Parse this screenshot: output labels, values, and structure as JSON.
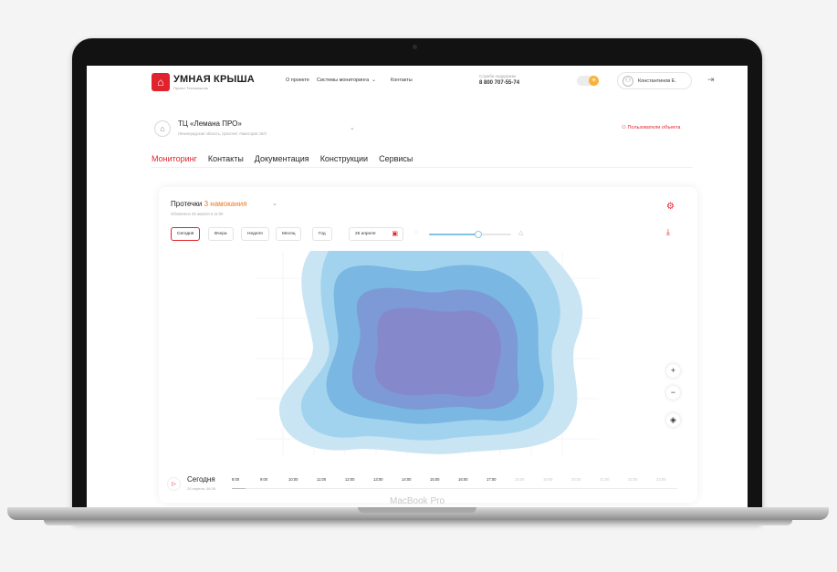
{
  "header": {
    "brand_title": "УМНАЯ КРЫША",
    "brand_subtitle": "Проект Технониколь",
    "nav": [
      {
        "label": "О проекте"
      },
      {
        "label": "Системы мониторинга"
      },
      {
        "label": "Контакты"
      }
    ],
    "support_label": "Служба поддержки",
    "support_phone": "8 800 707-55-74",
    "user_name": "Константинов Е."
  },
  "object": {
    "title": "ТЦ «Лемана ПРО»",
    "address": "Ленинградская область, проспект Авиаторов 16/3",
    "users_link": "Пользователи объекта"
  },
  "tabs": [
    {
      "label": "Мониторинг",
      "active": true
    },
    {
      "label": "Контакты",
      "active": false
    },
    {
      "label": "Документация",
      "active": false
    },
    {
      "label": "Конструкции",
      "active": false
    },
    {
      "label": "Сервисы",
      "active": false
    }
  ],
  "card": {
    "title": "Протечки",
    "count_label": "3 намокания",
    "updated": "Обновлено 25 апреля в 11:00",
    "periods": [
      {
        "label": "Сегодня",
        "active": true
      },
      {
        "label": "Вчера",
        "active": false
      },
      {
        "label": "Неделя",
        "active": false
      },
      {
        "label": "Месяц",
        "active": false
      },
      {
        "label": "Год",
        "active": false
      }
    ],
    "date_value": "25 апреля",
    "slider_level": 0.6,
    "zoom": {
      "plus": "+",
      "minus": "−"
    }
  },
  "timeline": {
    "title": "Сегодня",
    "subtitle": "25 апреля, 08:36",
    "hours": [
      "8:00",
      "9:00",
      "10:00",
      "11:00",
      "12:00",
      "13:00",
      "14:00",
      "15:00",
      "16:00",
      "17:00",
      "18:00",
      "19:00",
      "20:00",
      "21:00",
      "22:00",
      "23:00"
    ],
    "active_until_index": 9,
    "progress": 0.03
  },
  "device": {
    "label": "MacBook Pro"
  },
  "colors": {
    "accent": "#e1232e",
    "count": "#f0771f",
    "leak_levels": [
      "#c9e5f4",
      "#a2d3ee",
      "#7ab7e2",
      "#7d9ad6",
      "#8688cc"
    ]
  }
}
